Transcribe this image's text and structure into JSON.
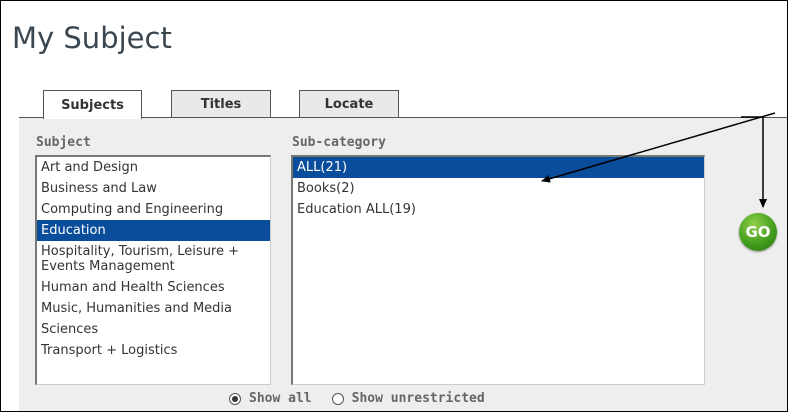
{
  "title": "My Subject",
  "tabs": [
    {
      "label": "Subjects",
      "active": true
    },
    {
      "label": "Titles",
      "active": false
    },
    {
      "label": "Locate",
      "active": false
    }
  ],
  "subject": {
    "label": "Subject",
    "items": [
      "Art and Design",
      "Business and Law",
      "Computing and Engineering",
      "Education",
      "Hospitality, Tourism, Leisure + Events Management",
      "Human and Health Sciences",
      "Music, Humanities and Media",
      "Sciences",
      "Transport + Logistics"
    ],
    "selected": "Education"
  },
  "subcategory": {
    "label": "Sub-category",
    "items": [
      "ALL(21)",
      "Books(2)",
      "Education ALL(19)"
    ],
    "selected": "ALL(21)"
  },
  "go_label": "GO",
  "radios": [
    {
      "label": "Show all",
      "checked": true
    },
    {
      "label": "Show unrestricted",
      "checked": false
    }
  ],
  "colors": {
    "selection": "#0a4d9a",
    "go_button": "#3f9a1b"
  }
}
